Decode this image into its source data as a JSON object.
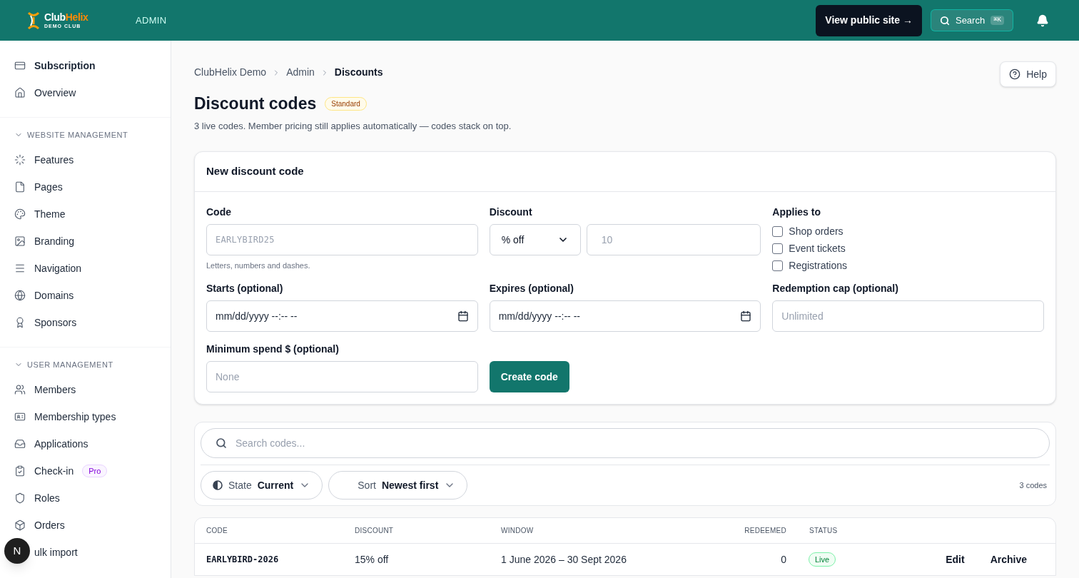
{
  "header": {
    "logo": {
      "name_a": "Club",
      "name_b": "Helix",
      "tagline": "DEMO CLUB"
    },
    "section": "ADMIN",
    "view_site": "View public site →",
    "search": {
      "label": "Search",
      "shortcut": "⌘K"
    }
  },
  "sidebar": {
    "top_items": [
      {
        "label": "Subscription",
        "selected": true
      },
      {
        "label": "Overview",
        "selected": false
      }
    ],
    "sections": [
      {
        "title": "WEBSITE MANAGEMENT",
        "expanded": true,
        "items": [
          {
            "label": "Features",
            "selected": false
          },
          {
            "label": "Pages",
            "selected": false
          },
          {
            "label": "Theme",
            "selected": false
          },
          {
            "label": "Branding",
            "selected": false
          },
          {
            "label": "Navigation",
            "selected": false
          },
          {
            "label": "Domains",
            "selected": false
          },
          {
            "label": "Sponsors",
            "selected": false
          }
        ]
      },
      {
        "title": "USER MANAGEMENT",
        "expanded": true,
        "items": [
          {
            "label": "Members",
            "selected": false
          },
          {
            "label": "Membership types",
            "selected": false
          },
          {
            "label": "Applications",
            "selected": false
          },
          {
            "label": "Check-in",
            "selected": false,
            "badge": "Pro"
          },
          {
            "label": "Roles",
            "selected": false
          },
          {
            "label": "Orders",
            "selected": false
          },
          {
            "label": "ulk import",
            "selected": false
          }
        ]
      }
    ]
  },
  "floating_avatar": "N",
  "breadcrumb": [
    "ClubHelix Demo",
    "Admin",
    "Discounts"
  ],
  "help": "Help",
  "title": "Discount codes",
  "plan_badge": "Standard",
  "subtitle": "3 live codes. Member pricing still applies automatically — codes stack on top.",
  "form": {
    "title": "New discount code",
    "code": {
      "label": "Code",
      "placeholder": "EARLYBIRD25",
      "hint": "Letters, numbers and dashes."
    },
    "discount": {
      "label": "Discount",
      "type": "% off",
      "placeholder": "10"
    },
    "applies_to": {
      "label": "Applies to",
      "options": [
        {
          "label": "Shop orders",
          "checked": false
        },
        {
          "label": "Event tickets",
          "checked": false
        },
        {
          "label": "Registrations",
          "checked": false
        }
      ]
    },
    "starts": {
      "label": "Starts (optional)",
      "placeholder": "mm/dd/yyyy --:-- --"
    },
    "expires": {
      "label": "Expires (optional)",
      "placeholder": "mm/dd/yyyy --:-- --"
    },
    "cap": {
      "label": "Redemption cap (optional)",
      "placeholder": "Unlimited"
    },
    "min_spend": {
      "label": "Minimum spend $ (optional)",
      "placeholder": "None"
    },
    "submit": "Create code"
  },
  "filters": {
    "search_placeholder": "Search codes...",
    "state": {
      "label": "State",
      "value": "Current"
    },
    "sort": {
      "label": "Sort",
      "value": "Newest first"
    },
    "count": "3 codes"
  },
  "table": {
    "columns": [
      "CODE",
      "DISCOUNT",
      "WINDOW",
      "REDEEMED",
      "STATUS"
    ],
    "rows": [
      {
        "code": "EARLYBIRD-2026",
        "discount": "15% off",
        "window": "1 June 2026 – 30 Sept 2026",
        "redeemed": "0",
        "status": "Live",
        "actions": [
          "Edit",
          "Archive"
        ]
      }
    ]
  }
}
